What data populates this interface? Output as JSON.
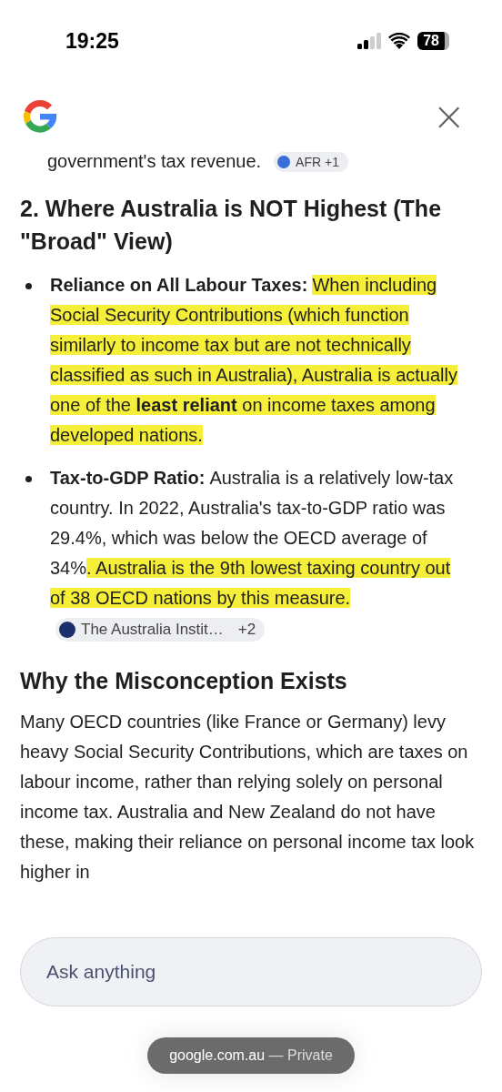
{
  "status_bar": {
    "time": "19:25",
    "battery": "78"
  },
  "header": {
    "close": "×"
  },
  "content": {
    "cut_line": {
      "text": "government's tax revenue.",
      "chip": "AFR +1"
    },
    "section_heading": "2. Where Australia is NOT Highest (The \"Broad\" View)",
    "bullets": [
      {
        "label": "Reliance on All Labour Taxes:",
        "segments": [
          {
            "text": "When including Social Security Contributions (which function similarly to income tax but are not technically classified as such in Australia), Australia is actually one of the **least reliant** on income taxes among developed nations.",
            "highlighted": true
          }
        ]
      },
      {
        "label": "Tax-to-GDP Ratio:",
        "segments": [
          {
            "text": "Australia is a relatively low-tax country. In 2022, Australia's tax-to-GDP ratio was 29.4%, which was below the OECD average of 34%",
            "highlighted": false
          },
          {
            "text": ". Australia is the 9th lowest taxing country out of 38 OECD nations by this measure.",
            "highlighted": true
          }
        ],
        "chip": {
          "source": "The Australia Instit…",
          "more": "+2"
        }
      }
    ],
    "heading2": "Why the Misconception Exists",
    "paragraph": "Many OECD countries (like France or Germany) levy heavy Social Security Contributions, which are taxes on labour income, rather than relying solely on personal income tax. Australia and New Zealand do not have these, making their reliance on personal income tax look higher in"
  },
  "ask": {
    "placeholder": "Ask anything"
  },
  "url_pill": {
    "domain": "google.com.au",
    "mode": "— Private"
  }
}
